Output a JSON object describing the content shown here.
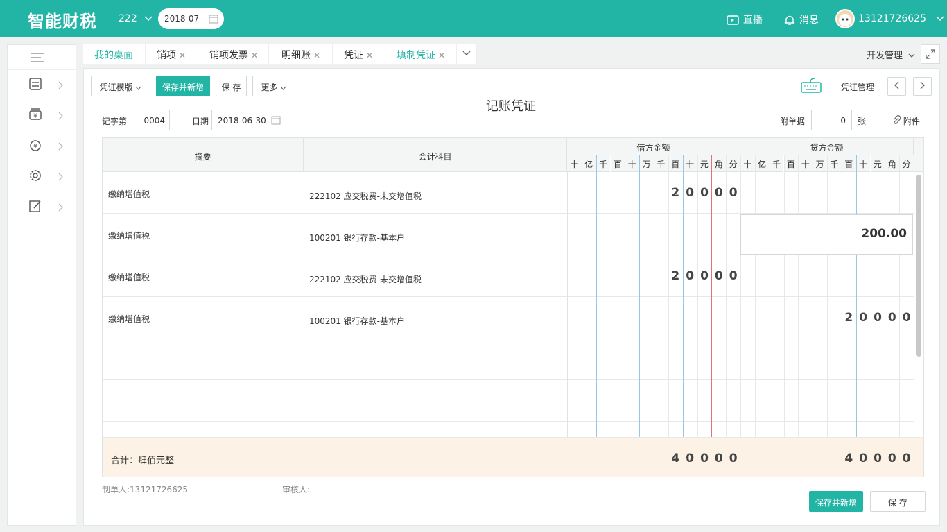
{
  "header": {
    "brand": "智能财税",
    "company": "222",
    "period": "2018-07",
    "live": "直播",
    "messages": "消息",
    "user": "13121726625"
  },
  "tabs": [
    {
      "label": "我的桌面",
      "closable": false,
      "active": true
    },
    {
      "label": "销项",
      "closable": true
    },
    {
      "label": "销项发票",
      "closable": true
    },
    {
      "label": "明细账",
      "closable": true
    },
    {
      "label": "凭证",
      "closable": true
    },
    {
      "label": "填制凭证",
      "closable": true,
      "active": true
    }
  ],
  "dev_menu": "开发管理",
  "toolbar": {
    "template": "凭证模版",
    "save_new": "保存并新增",
    "save": "保 存",
    "more": "更多",
    "voucher_mgmt": "凭证管理"
  },
  "voucher": {
    "title": "记账凭证",
    "word_label": "记字第",
    "word_no": "0004",
    "date_label": "日期",
    "date": "2018-06-30",
    "attach_label": "附单据",
    "attach_count": "0",
    "attach_unit": "张",
    "attachment": "附件"
  },
  "columns": {
    "summary": "摘要",
    "account": "会计科目",
    "debit": "借方金额",
    "credit": "贷方金额",
    "units": [
      "十",
      "亿",
      "千",
      "百",
      "十",
      "万",
      "千",
      "百",
      "十",
      "元",
      "角",
      "分"
    ]
  },
  "entries": [
    {
      "summary": "缴纳增值税",
      "account": "222102 应交税费-未交增值税",
      "debit_digits": [
        "2",
        "0",
        "0",
        "0",
        "0"
      ],
      "credit_digits": []
    },
    {
      "summary": "缴纳增值税",
      "account": "100201 银行存款-基本户",
      "debit_digits": [],
      "credit_edit": "200.00"
    },
    {
      "summary": "缴纳增值税",
      "account": "222102 应交税费-未交增值税",
      "debit_digits": [
        "2",
        "0",
        "0",
        "0",
        "0"
      ],
      "credit_digits": []
    },
    {
      "summary": "缴纳增值税",
      "account": "100201 银行存款-基本户",
      "debit_digits": [],
      "credit_digits": [
        "2",
        "0",
        "0",
        "0",
        "0"
      ]
    }
  ],
  "total": {
    "label": "合计：肆佰元整",
    "debit_digits": [
      "4",
      "0",
      "0",
      "0",
      "0"
    ],
    "credit_digits": [
      "4",
      "0",
      "0",
      "0",
      "0"
    ]
  },
  "footer": {
    "maker": "制单人:13121726625",
    "reviewer": "审核人:",
    "save_new": "保存并新增",
    "save": "保 存"
  },
  "colors": {
    "brand": "#22b5a6",
    "total_bg": "#fcf3e6"
  }
}
